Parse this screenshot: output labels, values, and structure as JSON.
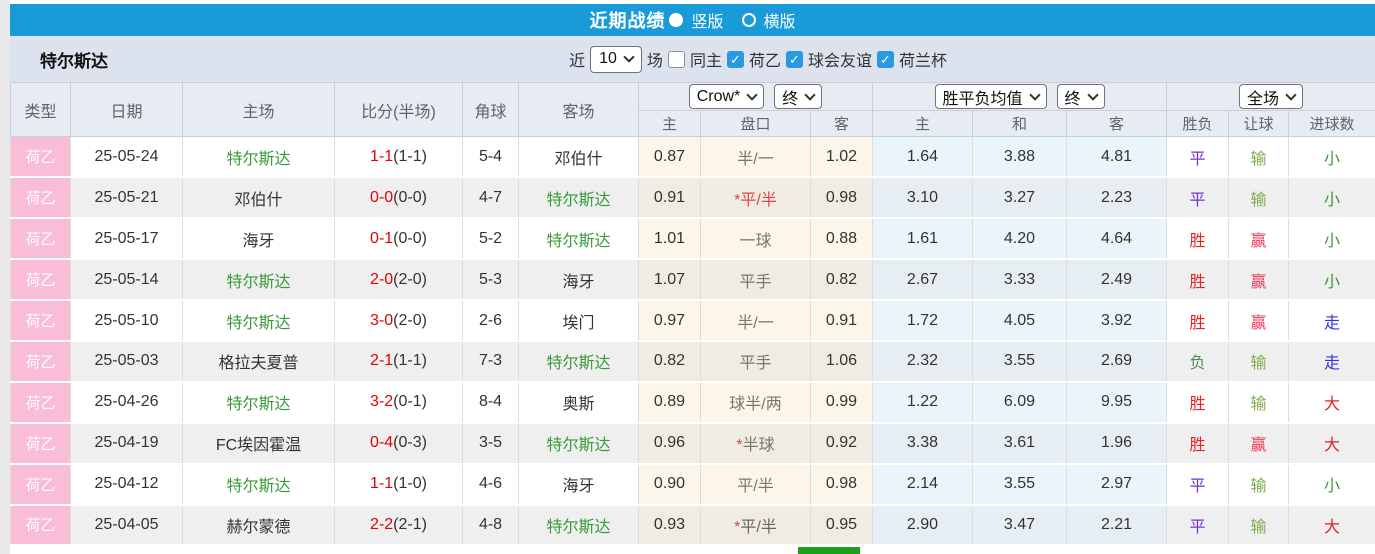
{
  "colors": {
    "accent_blue": "#199bd9",
    "type_pink": "#f9bdd7",
    "team_green": "#3a9a3a",
    "score_red": "#e60000"
  },
  "topbar": {
    "title": "近期战绩",
    "radio_vertical": "竖版",
    "radio_horizontal": "横版",
    "selected": "竖版"
  },
  "controls": {
    "team": "特尔斯达",
    "near_label": "近",
    "matches_count": "10",
    "matches_label": "场",
    "same_home": {
      "label": "同主",
      "checked": false
    },
    "filters": [
      {
        "label": "荷乙",
        "checked": true
      },
      {
        "label": "球会友谊",
        "checked": true
      },
      {
        "label": "荷兰杯",
        "checked": true
      }
    ]
  },
  "table": {
    "columns": {
      "type": "类型",
      "date": "日期",
      "home": "主场",
      "score": "比分(半场)",
      "corner": "角球",
      "away": "客场"
    },
    "dropdowns": {
      "company": "Crow*",
      "company_state": "终",
      "avg": "胜平负均值",
      "avg_state": "终",
      "scope": "全场"
    },
    "subheaders": {
      "odds_home": "主",
      "handicap": "盘口",
      "odds_away": "客",
      "avg_home": "主",
      "avg_draw": "和",
      "avg_away": "客",
      "result": "胜负",
      "let_goal": "让球",
      "goals": "进球数"
    },
    "rows": [
      {
        "type": "荷乙",
        "date": "25-05-24",
        "home": "特尔斯达",
        "home_color": "#3a9a3a",
        "score_ft": "1-1",
        "score_ht": "(1-1)",
        "corner": "5-4",
        "away": "邓伯什",
        "away_color": "#333333",
        "odds_home": "0.87",
        "handicap_star": "",
        "handicap": "半/一",
        "handicap_color": "#7d7567",
        "odds_away": "1.02",
        "avg_home": "1.64",
        "avg_draw": "3.88",
        "avg_away": "4.81",
        "result": "平",
        "result_color": "#7333d6",
        "let_goal": "输",
        "let_color": "#7faa4b",
        "goals": "小",
        "goals_color": "#3a9a3a"
      },
      {
        "type": "荷乙",
        "date": "25-05-21",
        "home": "邓伯什",
        "home_color": "#333333",
        "score_ft": "0-0",
        "score_ht": "(0-0)",
        "corner": "4-7",
        "away": "特尔斯达",
        "away_color": "#3a9a3a",
        "odds_home": "0.91",
        "handicap_star": "*",
        "handicap": "平/半",
        "handicap_color": "#e64444",
        "odds_away": "0.98",
        "avg_home": "3.10",
        "avg_draw": "3.27",
        "avg_away": "2.23",
        "result": "平",
        "result_color": "#7333d6",
        "let_goal": "输",
        "let_color": "#7faa4b",
        "goals": "小",
        "goals_color": "#3a9a3a"
      },
      {
        "type": "荷乙",
        "date": "25-05-17",
        "home": "海牙",
        "home_color": "#333333",
        "score_ft": "0-1",
        "score_ht": "(0-0)",
        "corner": "5-2",
        "away": "特尔斯达",
        "away_color": "#3a9a3a",
        "odds_home": "1.01",
        "handicap_star": "",
        "handicap": "一球",
        "handicap_color": "#7d7567",
        "odds_away": "0.88",
        "avg_home": "1.61",
        "avg_draw": "4.20",
        "avg_away": "4.64",
        "result": "胜",
        "result_color": "#e62222",
        "let_goal": "赢",
        "let_color": "#ee3b5c",
        "goals": "小",
        "goals_color": "#3a9a3a"
      },
      {
        "type": "荷乙",
        "date": "25-05-14",
        "home": "特尔斯达",
        "home_color": "#3a9a3a",
        "score_ft": "2-0",
        "score_ht": "(2-0)",
        "corner": "5-3",
        "away": "海牙",
        "away_color": "#333333",
        "odds_home": "1.07",
        "handicap_star": "",
        "handicap": "平手",
        "handicap_color": "#7d7567",
        "odds_away": "0.82",
        "avg_home": "2.67",
        "avg_draw": "3.33",
        "avg_away": "2.49",
        "result": "胜",
        "result_color": "#e62222",
        "let_goal": "赢",
        "let_color": "#ee3b5c",
        "goals": "小",
        "goals_color": "#3a9a3a"
      },
      {
        "type": "荷乙",
        "date": "25-05-10",
        "home": "特尔斯达",
        "home_color": "#3a9a3a",
        "score_ft": "3-0",
        "score_ht": "(2-0)",
        "corner": "2-6",
        "away": "埃门",
        "away_color": "#333333",
        "odds_home": "0.97",
        "handicap_star": "",
        "handicap": "半/一",
        "handicap_color": "#7d7567",
        "odds_away": "0.91",
        "avg_home": "1.72",
        "avg_draw": "4.05",
        "avg_away": "3.92",
        "result": "胜",
        "result_color": "#e62222",
        "let_goal": "赢",
        "let_color": "#ee3b5c",
        "goals": "走",
        "goals_color": "#3333e6"
      },
      {
        "type": "荷乙",
        "date": "25-05-03",
        "home": "格拉夫夏普",
        "home_color": "#333333",
        "score_ft": "2-1",
        "score_ht": "(1-1)",
        "corner": "7-3",
        "away": "特尔斯达",
        "away_color": "#3a9a3a",
        "odds_home": "0.82",
        "handicap_star": "",
        "handicap": "平手",
        "handicap_color": "#7d7567",
        "odds_away": "1.06",
        "avg_home": "2.32",
        "avg_draw": "3.55",
        "avg_away": "2.69",
        "result": "负",
        "result_color": "#4e8f52",
        "let_goal": "输",
        "let_color": "#7faa4b",
        "goals": "走",
        "goals_color": "#3333e6"
      },
      {
        "type": "荷乙",
        "date": "25-04-26",
        "home": "特尔斯达",
        "home_color": "#3a9a3a",
        "score_ft": "3-2",
        "score_ht": "(0-1)",
        "corner": "8-4",
        "away": "奥斯",
        "away_color": "#333333",
        "odds_home": "0.89",
        "handicap_star": "",
        "handicap": "球半/两",
        "handicap_color": "#7d7567",
        "odds_away": "0.99",
        "avg_home": "1.22",
        "avg_draw": "6.09",
        "avg_away": "9.95",
        "result": "胜",
        "result_color": "#e62222",
        "let_goal": "输",
        "let_color": "#7faa4b",
        "goals": "大",
        "goals_color": "#e62222"
      },
      {
        "type": "荷乙",
        "date": "25-04-19",
        "home": "FC埃因霍温",
        "home_color": "#333333",
        "score_ft": "0-4",
        "score_ht": "(0-3)",
        "corner": "3-5",
        "away": "特尔斯达",
        "away_color": "#3a9a3a",
        "odds_home": "0.96",
        "handicap_star": "*",
        "handicap": "半球",
        "handicap_color": "#7d7567",
        "odds_away": "0.92",
        "avg_home": "3.38",
        "avg_draw": "3.61",
        "avg_away": "1.96",
        "result": "胜",
        "result_color": "#e62222",
        "let_goal": "赢",
        "let_color": "#ee3b5c",
        "goals": "大",
        "goals_color": "#e62222"
      },
      {
        "type": "荷乙",
        "date": "25-04-12",
        "home": "特尔斯达",
        "home_color": "#3a9a3a",
        "score_ft": "1-1",
        "score_ht": "(1-0)",
        "corner": "4-6",
        "away": "海牙",
        "away_color": "#333333",
        "odds_home": "0.90",
        "handicap_star": "",
        "handicap": "平/半",
        "handicap_color": "#7d7567",
        "odds_away": "0.98",
        "avg_home": "2.14",
        "avg_draw": "3.55",
        "avg_away": "2.97",
        "result": "平",
        "result_color": "#7333d6",
        "let_goal": "输",
        "let_color": "#7faa4b",
        "goals": "小",
        "goals_color": "#3a9a3a"
      },
      {
        "type": "荷乙",
        "date": "25-04-05",
        "home": "赫尔蒙德",
        "home_color": "#333333",
        "score_ft": "2-2",
        "score_ht": "(2-1)",
        "corner": "4-8",
        "away": "特尔斯达",
        "away_color": "#3a9a3a",
        "odds_home": "0.93",
        "handicap_star": "*",
        "handicap": "平/半",
        "handicap_color": "#6e665c",
        "odds_away": "0.95",
        "avg_home": "2.90",
        "avg_draw": "3.47",
        "avg_away": "2.21",
        "result": "平",
        "result_color": "#7333d6",
        "let_goal": "输",
        "let_color": "#7faa4b",
        "goals": "大",
        "goals_color": "#e62222"
      }
    ]
  }
}
